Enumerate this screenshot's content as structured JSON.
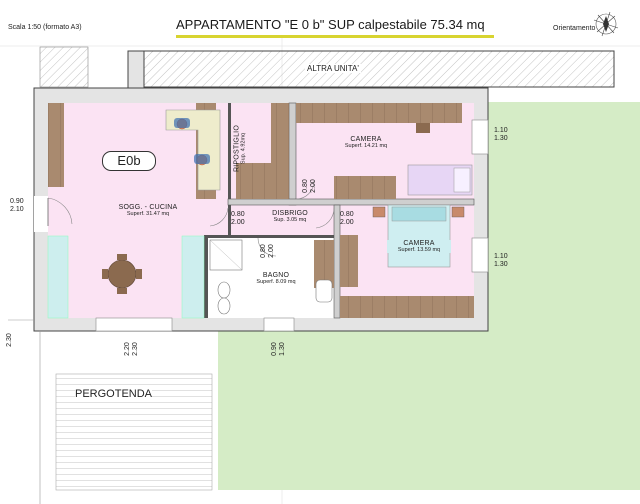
{
  "header": {
    "scale": "Scala 1:50 (formato A3)",
    "title": "APPARTAMENTO \"E 0 b\"   SUP calpestabile 75.34 mq",
    "orientation": "Orientamento"
  },
  "unit_badge": "E0b",
  "neighbor": "ALTRA UNITA'",
  "pergola": "PERGOTENDA",
  "rooms": {
    "living": {
      "name": "SOGG. - CUCINA",
      "area": "Superf. 31.47 mq"
    },
    "closet": {
      "name": "RIPOSTIGLIO",
      "area": "Sup. 4.92mq"
    },
    "bedroom1": {
      "name": "CAMERA",
      "area": "Superf. 14.21 mq"
    },
    "hall": {
      "name": "DISBRIGO",
      "area": "Sup. 3.05 mq"
    },
    "bedroom2": {
      "name": "CAMERA",
      "area": "Superf. 13.59 mq"
    },
    "bath": {
      "name": "BAGNO",
      "area": "Superf. 8.09 mq"
    }
  },
  "dimensions": {
    "entry": [
      "0.90",
      "2.10"
    ],
    "bed1_window": [
      "1.10",
      "1.30"
    ],
    "bed2_window": [
      "1.10",
      "1.30"
    ],
    "living_door": [
      "0.80",
      "2.00"
    ],
    "hall_door_right": [
      "0.80",
      "2.00"
    ],
    "bath_door": [
      "0.80",
      "2.00"
    ],
    "closet_door": [
      "0.80",
      "2.00"
    ],
    "living_window_bottom": [
      "2.20",
      "2.30"
    ],
    "bath_window_bottom": [
      "0.90",
      "1.30"
    ],
    "left_edge": "2.30"
  },
  "colors": {
    "room_fill": "#fbe3f3",
    "garden": "#d5ecc6",
    "wall": "#e4e4e4",
    "wall_stroke": "#444444",
    "wood": "#a98a6f",
    "title_underline": "#d8d430",
    "badge_border": "#333333"
  }
}
